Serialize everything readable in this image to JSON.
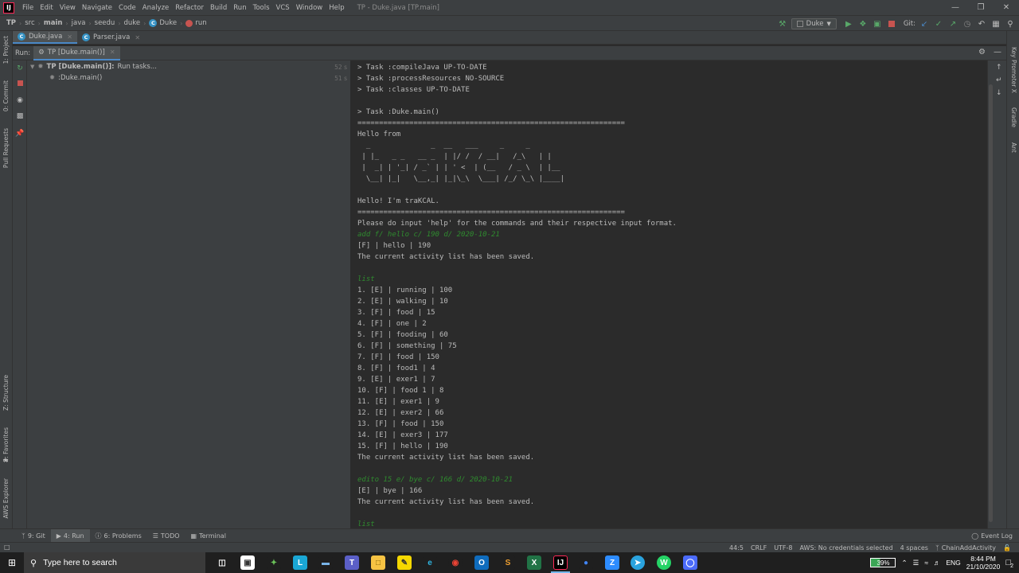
{
  "menu": {
    "items": [
      "File",
      "Edit",
      "View",
      "Navigate",
      "Code",
      "Analyze",
      "Refactor",
      "Build",
      "Run",
      "Tools",
      "VCS",
      "Window",
      "Help"
    ],
    "window_title": "TP - Duke.java [TP.main]"
  },
  "navbar": {
    "crumbs": [
      "TP",
      "src",
      "main",
      "java",
      "seedu",
      "duke",
      "Duke",
      "run"
    ],
    "run_config": "Duke",
    "git_label": "Git:"
  },
  "editor_tabs": [
    {
      "label": "Duke.java"
    },
    {
      "label": "Parser.java"
    }
  ],
  "left_strip": {
    "project": "1: Project",
    "commit": "0: Commit",
    "pull_requests": "Pull Requests",
    "structure": "Z: Structure",
    "favorites": "2: Favorites",
    "aws": "AWS Explorer"
  },
  "right_strip": {
    "key_promoter": "Key Promoter X",
    "gradle": "Gradle",
    "ant": "Ant"
  },
  "run_window": {
    "label": "Run:",
    "tab": "TP [Duke.main()]"
  },
  "tree": {
    "root_bold": "TP [Duke.main()]:",
    "root_rest": "Run tasks...",
    "child": ":Duke.main()",
    "root_time": "52 s",
    "child_time": "51 s"
  },
  "console": {
    "lines": [
      {
        "text": "> Task :compileJava UP-TO-DATE",
        "kind": "out"
      },
      {
        "text": "> Task :processResources NO-SOURCE",
        "kind": "out"
      },
      {
        "text": "> Task :classes UP-TO-DATE",
        "kind": "out"
      },
      {
        "text": "",
        "kind": "out"
      },
      {
        "text": "> Task :Duke.main()",
        "kind": "out"
      },
      {
        "text": "==============================================================",
        "kind": "out"
      },
      {
        "text": "Hello from",
        "kind": "out"
      },
      {
        "text": "  _              _  __   ___     _     _",
        "kind": "out"
      },
      {
        "text": " | |_   _ _   __ _  | |/ /  / __|   /_\\   | |",
        "kind": "out"
      },
      {
        "text": " |  _| | '_| / _` | | ' <  | (__   / _ \\  | |__",
        "kind": "out"
      },
      {
        "text": "  \\__| |_|   \\__,_| |_|\\_\\  \\___| /_/ \\_\\ |____|",
        "kind": "out"
      },
      {
        "text": "",
        "kind": "out"
      },
      {
        "text": "Hello! I'm traKCAL.",
        "kind": "out"
      },
      {
        "text": "==============================================================",
        "kind": "out"
      },
      {
        "text": "Please do input 'help' for the commands and their respective input format.",
        "kind": "out"
      },
      {
        "text": "add f/ hello c/ 190 d/ 2020-10-21",
        "kind": "input"
      },
      {
        "text": "[F] | hello | 190",
        "kind": "out"
      },
      {
        "text": "The current activity list has been saved.",
        "kind": "out"
      },
      {
        "text": "",
        "kind": "out"
      },
      {
        "text": "list",
        "kind": "input"
      },
      {
        "text": "1. [E] | running | 100",
        "kind": "out"
      },
      {
        "text": "2. [E] | walking | 10",
        "kind": "out"
      },
      {
        "text": "3. [F] | food | 15",
        "kind": "out"
      },
      {
        "text": "4. [F] | one | 2",
        "kind": "out"
      },
      {
        "text": "5. [F] | fooding | 60",
        "kind": "out"
      },
      {
        "text": "6. [F] | something | 75",
        "kind": "out"
      },
      {
        "text": "7. [F] | food | 150",
        "kind": "out"
      },
      {
        "text": "8. [F] | food1 | 4",
        "kind": "out"
      },
      {
        "text": "9. [E] | exer1 | 7",
        "kind": "out"
      },
      {
        "text": "10. [F] | food 1 | 8",
        "kind": "out"
      },
      {
        "text": "11. [E] | exer1 | 9",
        "kind": "out"
      },
      {
        "text": "12. [E] | exer2 | 66",
        "kind": "out"
      },
      {
        "text": "13. [F] | food | 150",
        "kind": "out"
      },
      {
        "text": "14. [E] | exer3 | 177",
        "kind": "out"
      },
      {
        "text": "15. [F] | hello | 190",
        "kind": "out"
      },
      {
        "text": "The current activity list has been saved.",
        "kind": "out"
      },
      {
        "text": "",
        "kind": "out"
      },
      {
        "text": "edito 15 e/ bye c/ 166 d/ 2020-10-21",
        "kind": "input"
      },
      {
        "text": "[E] | bye | 166",
        "kind": "out"
      },
      {
        "text": "The current activity list has been saved.",
        "kind": "out"
      },
      {
        "text": "",
        "kind": "out"
      },
      {
        "text": "list",
        "kind": "input"
      }
    ]
  },
  "bottom_tabs": {
    "git": "9: Git",
    "run": "4: Run",
    "problems": "6: Problems",
    "todo": "TODO",
    "terminal": "Terminal",
    "event_log": "Event Log"
  },
  "status": {
    "position": "44:5",
    "line_sep": "CRLF",
    "encoding": "UTF-8",
    "aws": "AWS: No credentials selected",
    "indent": "4 spaces",
    "branch": "ChainAddActivity"
  },
  "taskbar": {
    "search_placeholder": "Type here to search",
    "battery": "39%",
    "language": "ENG",
    "time": "8:44 PM",
    "date": "21/10/2020",
    "notifications": "2"
  },
  "colors": {
    "accent": "#4a88c7",
    "console_input": "#2f8b2f",
    "run_green": "#59a869",
    "stop_red": "#c75450"
  }
}
